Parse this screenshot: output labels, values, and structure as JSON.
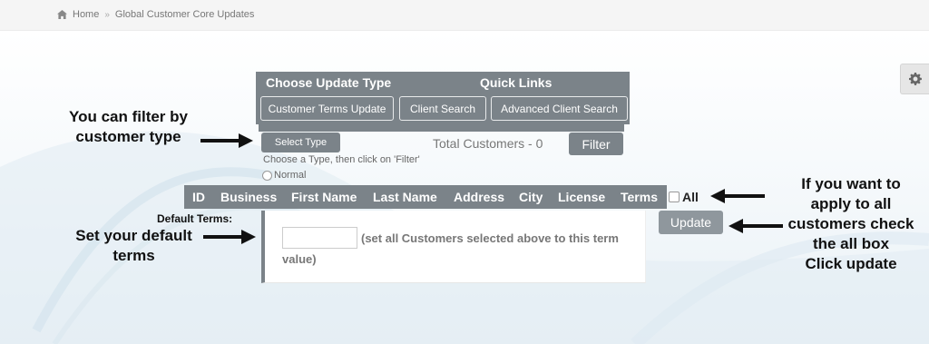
{
  "breadcrumb": {
    "home": "Home",
    "separator": "»",
    "current": "Global Customer Core Updates"
  },
  "panel": {
    "header_left": "Choose Update Type",
    "header_right": "Quick Links",
    "buttons": [
      "Customer Terms Update",
      "Client Search",
      "Advanced Client Search"
    ]
  },
  "filter": {
    "select_type": "Select Type",
    "total_customers": "Total Customers - 0",
    "filter_button": "Filter",
    "hint": "Choose a Type, then click on 'Filter'",
    "radio_normal": "Normal"
  },
  "table": {
    "columns": [
      "ID",
      "Business",
      "First Name",
      "Last Name",
      "Address",
      "City",
      "License",
      "Terms"
    ],
    "all_label": "All"
  },
  "terms": {
    "label": "Default Terms:",
    "input_value": "",
    "note_line1": "(set all Customers selected above to this term",
    "note_line2": "value)"
  },
  "update_button": "Update",
  "annotations": {
    "filter_line1": "You can filter by",
    "filter_line2": "customer type",
    "default_line1": "Set your default",
    "default_line2": "terms",
    "right_line1": "If you want to",
    "right_line2": "apply to all",
    "right_line3": "customers check",
    "right_line4": "the all box",
    "right_line5": "Click update"
  },
  "colors": {
    "primary_gray": "#7b8389",
    "update_gray": "#8f979d"
  },
  "icons": {
    "home": "home-icon",
    "settings": "gear-icon"
  }
}
